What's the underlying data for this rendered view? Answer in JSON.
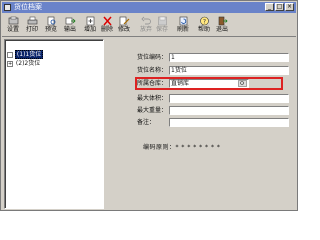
{
  "window": {
    "title": "货位档案"
  },
  "toolbar": {
    "buttons": [
      {
        "label": "设置",
        "icon": "settings-icon",
        "enabled": true
      },
      {
        "label": "打印",
        "icon": "print-icon",
        "enabled": true
      },
      {
        "label": "预览",
        "icon": "preview-icon",
        "enabled": true
      },
      {
        "label": "输出",
        "icon": "export-icon",
        "enabled": true
      },
      {
        "label": "增加",
        "icon": "add-icon",
        "enabled": true
      },
      {
        "label": "删除",
        "icon": "delete-icon",
        "enabled": true
      },
      {
        "label": "修改",
        "icon": "edit-icon",
        "enabled": true
      },
      {
        "label": "放弃",
        "icon": "undo-icon",
        "enabled": false
      },
      {
        "label": "保存",
        "icon": "save-icon",
        "enabled": false
      },
      {
        "label": "刷新",
        "icon": "refresh-icon",
        "enabled": true
      },
      {
        "label": "帮助",
        "icon": "help-icon",
        "enabled": true
      },
      {
        "label": "退出",
        "icon": "exit-icon",
        "enabled": true
      }
    ]
  },
  "tree": {
    "items": [
      {
        "label": "(1)1货位",
        "selected": true,
        "expander": ""
      },
      {
        "label": "(2)2货位",
        "selected": false,
        "expander": "+"
      }
    ]
  },
  "form": {
    "code_label": "货位编码：",
    "code_value": "1",
    "name_label": "货位名称：",
    "name_value": "1货位",
    "warehouse_label": "所属仓库：",
    "warehouse_value": "直销库",
    "volume_label": "最大体积：",
    "volume_value": "",
    "weight_label": "最大重量：",
    "weight_value": "",
    "note_label": "备注：",
    "note_value": "",
    "rule_label": "编码原则：",
    "rule_value": "* * * * * * * *"
  },
  "colors": {
    "titlebar": "#6a83c9",
    "highlight": "#dd2222",
    "selection": "#0a246a"
  }
}
